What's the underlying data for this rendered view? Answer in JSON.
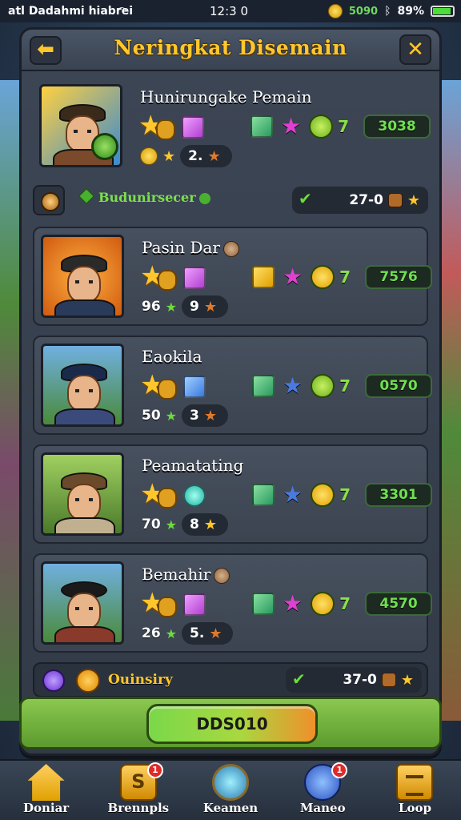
{
  "status_bar": {
    "carrier": "atl Dadahmi hiabrei",
    "time": "12:3 0",
    "coins": "5090",
    "battery": "89%"
  },
  "header": {
    "title": "Neringkat Disemain",
    "back_icon": "arrow-left-icon",
    "close_icon": "close-icon"
  },
  "featured_player": {
    "name": "Hunirungake Pemain",
    "score": "3038",
    "level_value": "2.",
    "level_prefix": "",
    "seven": "7"
  },
  "featured_bar": {
    "label": "Budunirsecer",
    "value": "27-0"
  },
  "players": [
    {
      "name": "Pasin Dar",
      "score": "7576",
      "level": "96",
      "count": "9",
      "seven": "7"
    },
    {
      "name": "Eaokila",
      "score": "0570",
      "level": "50",
      "count": "3",
      "seven": "7"
    },
    {
      "name": "Peamatating",
      "score": "3301",
      "level": "70",
      "count": "8",
      "seven": "7"
    },
    {
      "name": "Bemahir",
      "score": "4570",
      "level": "26",
      "count": "5.",
      "seven": "7"
    }
  ],
  "footer_bar": {
    "label": "Ouinsiry",
    "value": "37-0"
  },
  "main_button": {
    "label": "DDS010"
  },
  "nav": [
    {
      "label": "Doniar",
      "icon": "home-icon"
    },
    {
      "label": "Brennpls",
      "icon": "shield-icon",
      "badge": "1"
    },
    {
      "label": "Keamen",
      "icon": "orb-icon"
    },
    {
      "label": "Maneo",
      "icon": "globe-icon",
      "badge": "1"
    },
    {
      "label": "Loop",
      "icon": "box-icon"
    }
  ],
  "colors": {
    "accent_gold": "#ffc72c",
    "score_green": "#6fe050",
    "panel": "#3d4655"
  }
}
